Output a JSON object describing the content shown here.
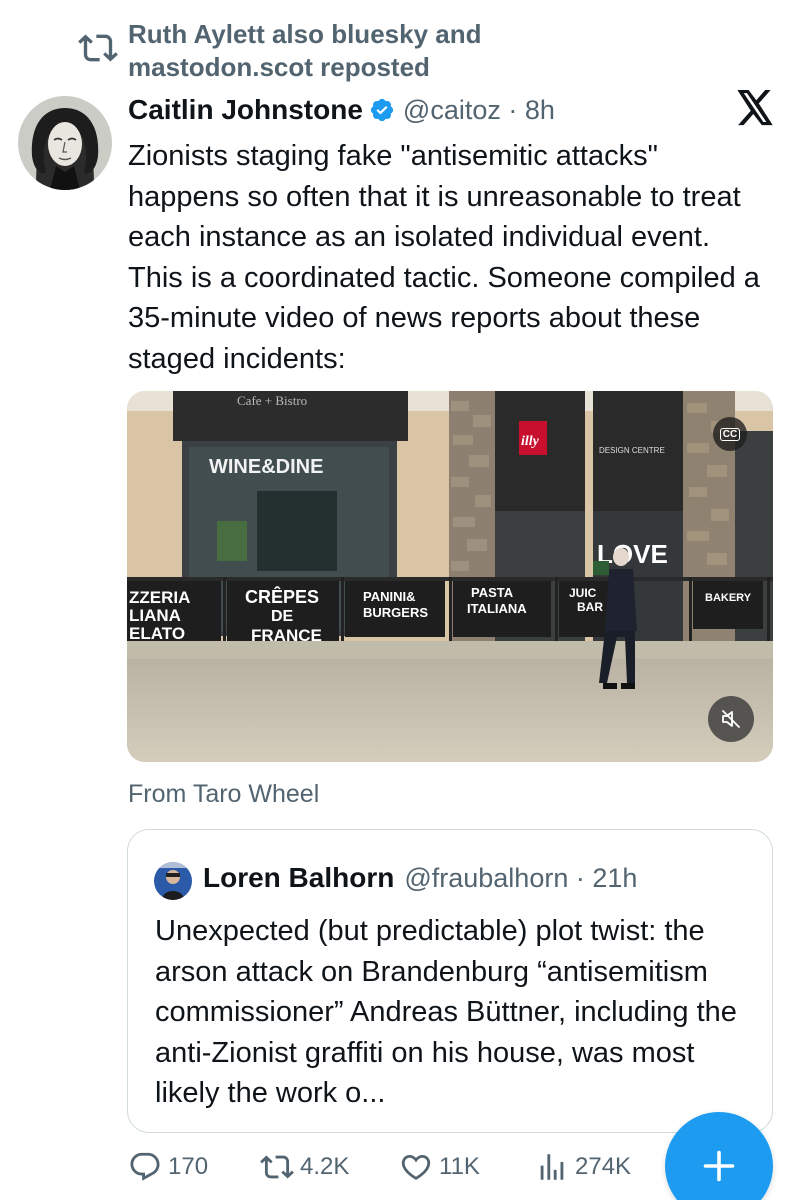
{
  "repost": {
    "text": "Ruth Aylett also bluesky and mastodon.scot reposted",
    "icon": "repost-icon"
  },
  "tweet": {
    "author_name": "Caitlin Johnstone",
    "handle_time": "@caitoz · 8h",
    "verified": true,
    "text": "Zionists staging fake \"antisemitic attacks\" happens so often that it is unreasonable to treat each instance as an isolated individual event. This is a coordinated tactic. Someone compiled a 35-minute video of news reports about these staged incidents:",
    "source_app_icon": "x-logo-icon"
  },
  "media": {
    "signs": {
      "cafe": "Cafe + Bistro",
      "wine": "WINE&DINE",
      "illy": "illy",
      "design": "DESIGN CENTRE",
      "love": "LOVE",
      "pizzeria": "ZZERIA",
      "pizzeria2": "LIANA",
      "gelato": "ELATO",
      "crepes1": "CRÊPES",
      "crepes2": "DE",
      "crepes3": "FRANCE",
      "panini1": "PANINI&",
      "panini2": "BURGERS",
      "pasta1": "PASTA",
      "pasta2": "ITALIANA",
      "juice1": "JUIC",
      "juice2": "BAR",
      "bakery": "BAKERY"
    },
    "cc_label": "CC",
    "mute_icon": "muted-speaker-icon"
  },
  "from_source": "From Taro Wheel",
  "quote": {
    "author_name": "Loren Balhorn",
    "handle_time": "@fraubalhorn · 21h",
    "text": "Unexpected (but predictable) plot twist: the arson attack on Brandenburg “antisemitism commissioner” Andreas Büttner, including the anti-Zionist graffiti on his house, was most likely the work o..."
  },
  "actions": {
    "replies": "170",
    "reposts": "4.2K",
    "likes": "11K",
    "views": "274K"
  },
  "colors": {
    "accent": "#1d9bf0",
    "secondary_text": "#536471",
    "border": "#cfd9de"
  }
}
